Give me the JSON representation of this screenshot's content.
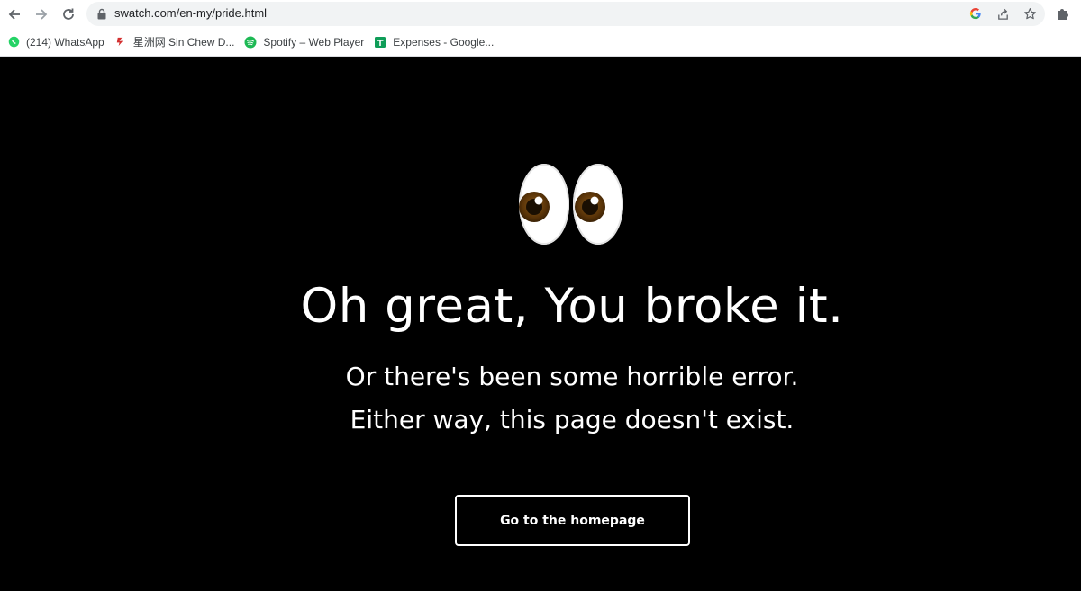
{
  "browser": {
    "url": "swatch.com/en-my/pride.html",
    "bookmarks": [
      {
        "label": "(214) WhatsApp",
        "icon": "whatsapp-icon",
        "color": "#25d366"
      },
      {
        "label": "星洲网 Sin Chew D...",
        "icon": "sinchew-icon",
        "color": "#d32f2f"
      },
      {
        "label": "Spotify – Web Player",
        "icon": "spotify-icon",
        "color": "#1db954"
      },
      {
        "label": "Expenses - Google...",
        "icon": "sheets-icon",
        "color": "#0f9d58"
      }
    ]
  },
  "page": {
    "headline": "Oh great, You broke it.",
    "line1": "Or there's been some horrible error.",
    "line2": "Either way, this page doesn't exist.",
    "button_label": "Go to the homepage",
    "background": "#000000",
    "text_color": "#ffffff"
  }
}
